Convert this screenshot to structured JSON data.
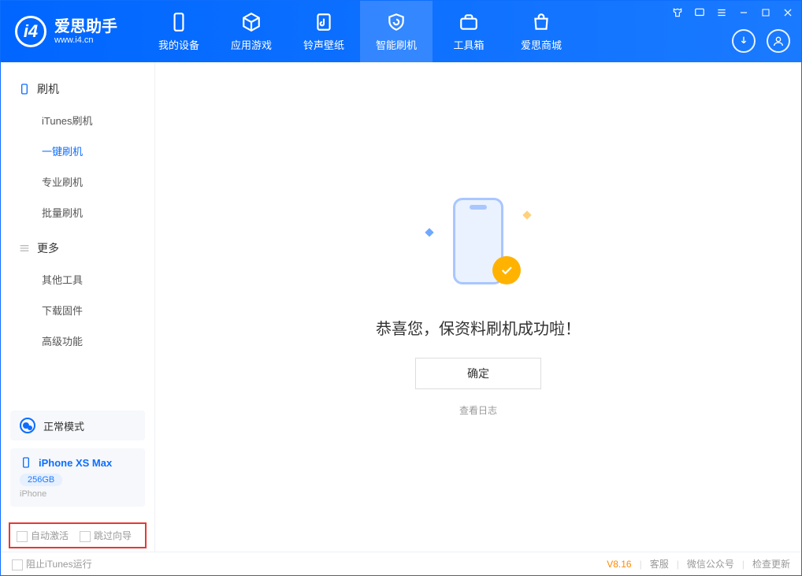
{
  "app": {
    "title": "爱思助手",
    "subtitle": "www.i4.cn"
  },
  "tabs": {
    "device": "我的设备",
    "apps": "应用游戏",
    "ring": "铃声壁纸",
    "flash": "智能刷机",
    "tools": "工具箱",
    "store": "爱思商城"
  },
  "sidebar": {
    "group1": "刷机",
    "items1": {
      "itunes": "iTunes刷机",
      "oneclick": "一键刷机",
      "pro": "专业刷机",
      "batch": "批量刷机"
    },
    "group2": "更多",
    "items2": {
      "other": "其他工具",
      "firmware": "下载固件",
      "advanced": "高级功能"
    }
  },
  "device": {
    "mode": "正常模式",
    "name": "iPhone XS Max",
    "capacity": "256GB",
    "type": "iPhone"
  },
  "options": {
    "auto_activate": "自动激活",
    "skip_guide": "跳过向导"
  },
  "main": {
    "success_msg": "恭喜您，保资料刷机成功啦！",
    "ok": "确定",
    "view_log": "查看日志"
  },
  "footer": {
    "block_itunes": "阻止iTunes运行",
    "version": "V8.16",
    "support": "客服",
    "wechat": "微信公众号",
    "update": "检查更新"
  }
}
